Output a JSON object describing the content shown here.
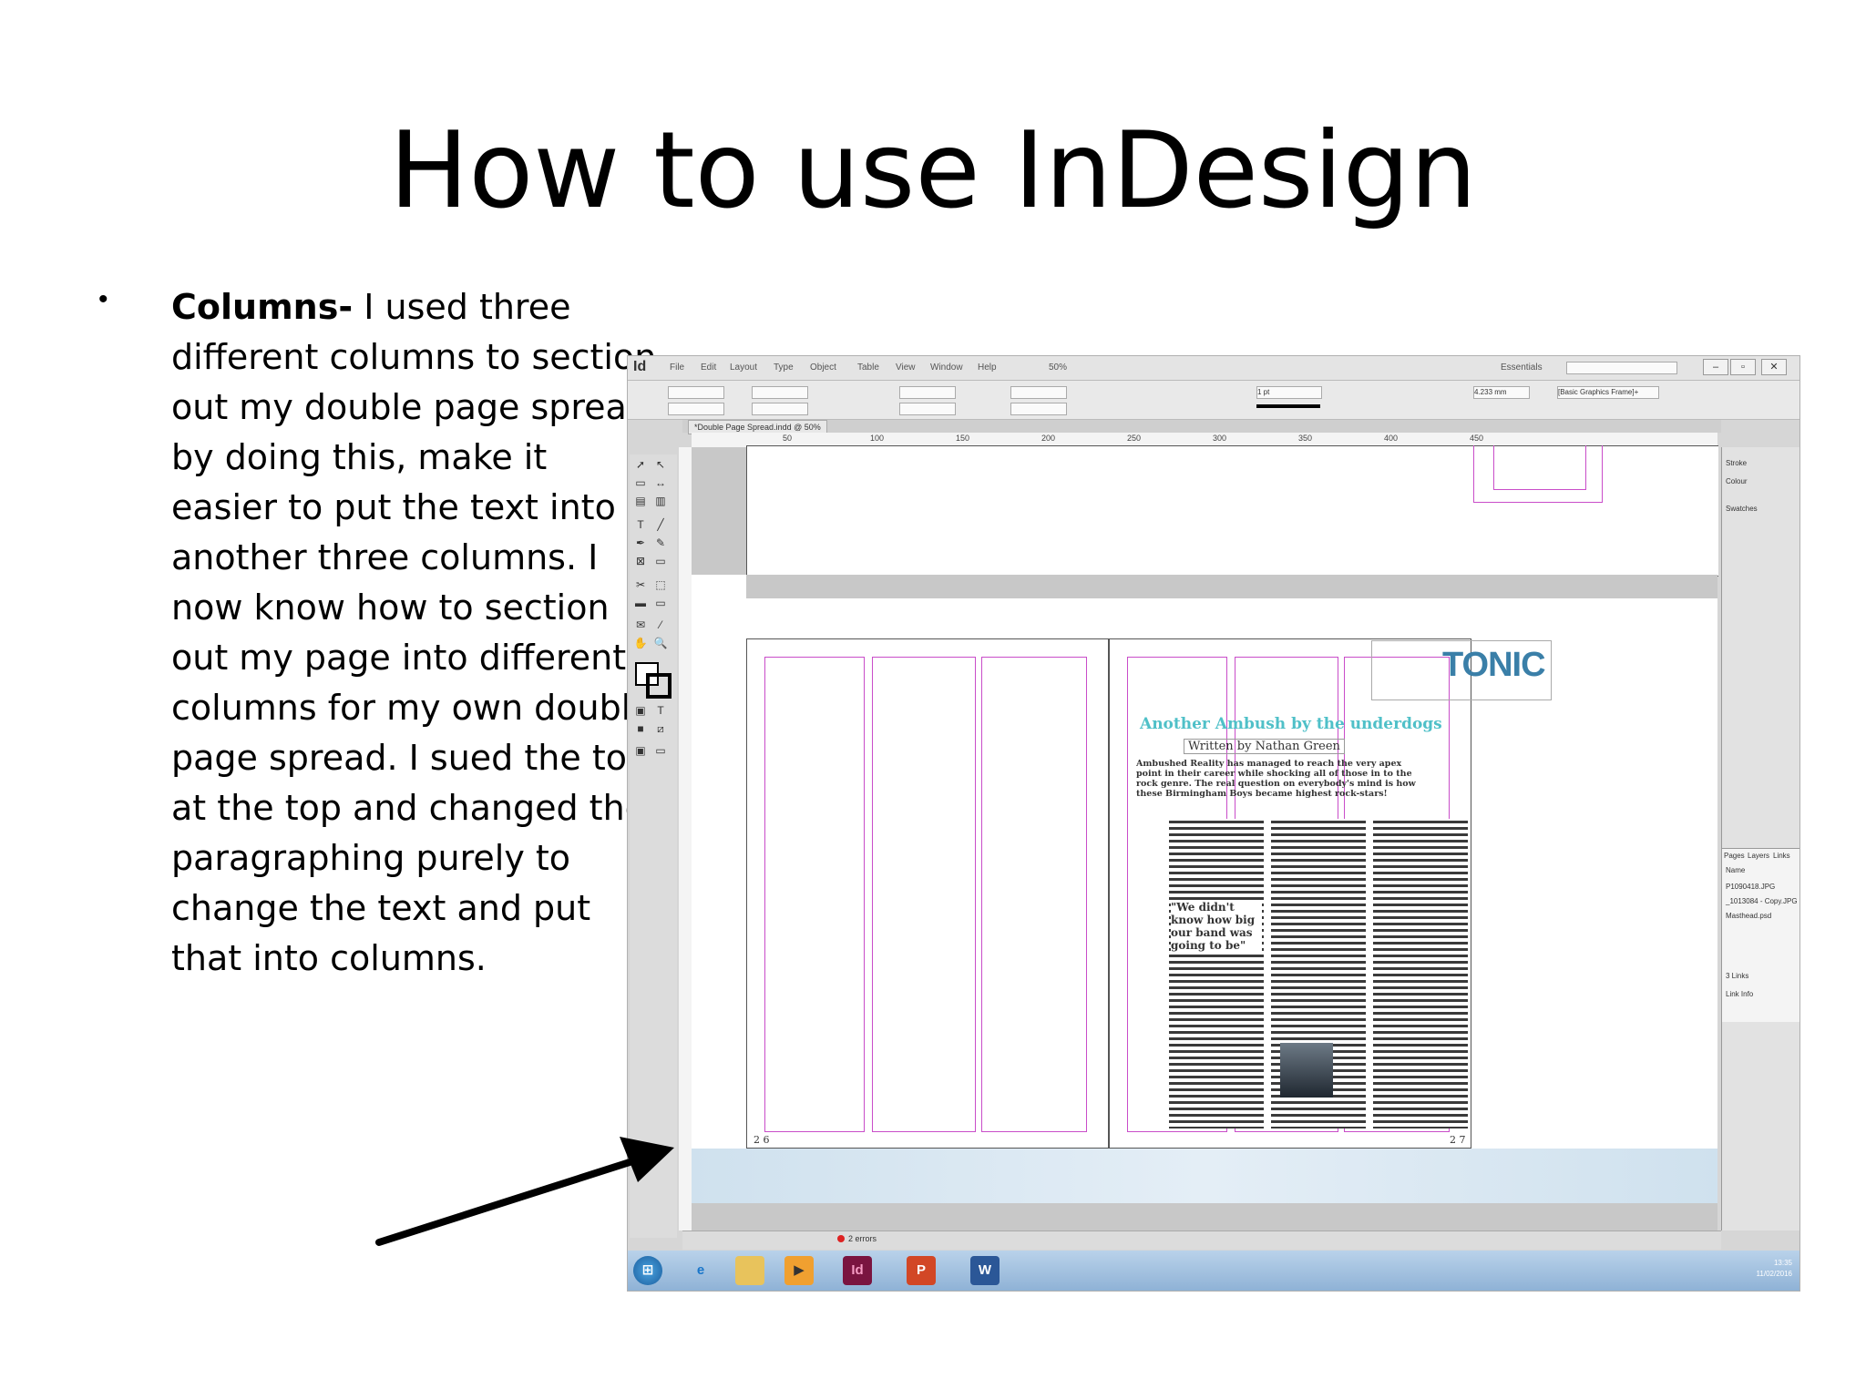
{
  "slide": {
    "title": "How to use InDesign",
    "bullet_heading": "Columns-",
    "bullet_body": " I used three different columns to section out my double page spread by doing this, make it easier to put the text into another three columns.  I now know how to section out my page into different columns for my own double page spread. I sued the tool at the top and changed the paragraphing purely to change the text and put that into columns."
  },
  "screenshot": {
    "app_logo": "Id",
    "menu": [
      "File",
      "Edit",
      "Layout",
      "Type",
      "Object",
      "Table",
      "View",
      "Window",
      "Help"
    ],
    "zoom": "50%",
    "workspace": "Essentials",
    "document_tab": "*Double Page Spread.indd @ 50%",
    "ruler_labels": [
      "50",
      "100",
      "150",
      "200",
      "250",
      "300",
      "350",
      "400",
      "450"
    ],
    "stroke_weight": "1 pt",
    "dimension": "4.233 mm",
    "frame_style": "[Basic Graphics Frame]+",
    "panels": {
      "stroke": "Stroke",
      "colour": "Colour",
      "swatches": "Swatches",
      "tabs": [
        "Pages",
        "Layers",
        "Links"
      ],
      "name_header": "Name",
      "links": [
        "P1090418.JPG",
        "_1013084 - Copy.JPG",
        "Masthead.psd"
      ],
      "link_count": "3 Links",
      "link_info": "Link Info"
    },
    "article": {
      "masthead": "TONIC",
      "headline": "Another Ambush by the underdogs",
      "byline": "Written by Nathan Green",
      "standfirst": "Ambushed Reality has managed to reach the very apex point in their career while shocking all of those in to the rock genre. The real question on everybody's mind is how these Birmingham Boys became highest rock-stars!",
      "pull_quote": "\"We didn't know how big our band was going to be\"",
      "page_left": "2 6",
      "page_right": "2 7"
    },
    "status": "2 errors",
    "clock_time": "13:35",
    "clock_date": "11/02/2016"
  }
}
